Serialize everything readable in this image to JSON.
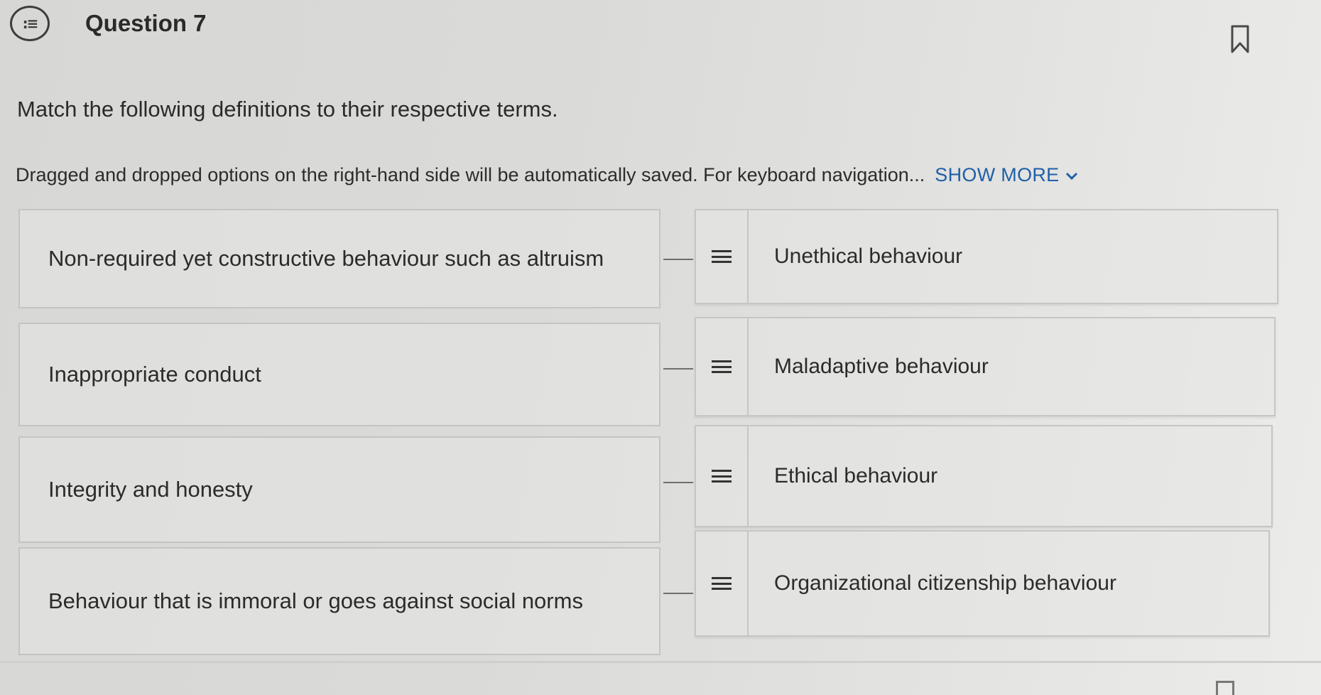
{
  "question": {
    "icon": "list-icon",
    "title": "Question 7",
    "bookmark_icon": "bookmark-icon"
  },
  "prompt": "Match the following definitions to their respective terms.",
  "instructions": {
    "text": "Dragged and dropped options on the right-hand side will be automatically saved. For keyboard navigation...",
    "show_more_label": "SHOW MORE",
    "link_color": "#1f5fa8"
  },
  "definitions": [
    {
      "text": "Non-required yet constructive behaviour such as altruism"
    },
    {
      "text": "Inappropriate conduct"
    },
    {
      "text": "Integrity and honesty"
    },
    {
      "text": "Behaviour that is immoral or goes against social norms"
    }
  ],
  "terms": [
    {
      "text": "Unethical behaviour",
      "handle_icon": "drag-handle-icon"
    },
    {
      "text": "Maladaptive behaviour",
      "handle_icon": "drag-handle-icon"
    },
    {
      "text": "Ethical behaviour",
      "handle_icon": "drag-handle-icon"
    },
    {
      "text": "Organizational citizenship behaviour",
      "handle_icon": "drag-handle-icon"
    }
  ]
}
